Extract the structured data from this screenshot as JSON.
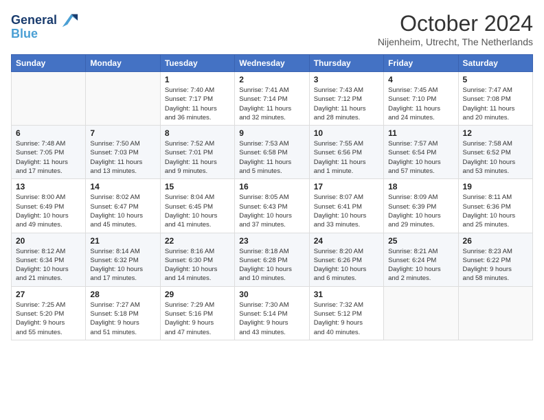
{
  "header": {
    "logo_line1": "General",
    "logo_line2": "Blue",
    "title": "October 2024",
    "subtitle": "Nijenheim, Utrecht, The Netherlands"
  },
  "calendar": {
    "days": [
      "Sunday",
      "Monday",
      "Tuesday",
      "Wednesday",
      "Thursday",
      "Friday",
      "Saturday"
    ],
    "weeks": [
      [
        {
          "day": "",
          "content": ""
        },
        {
          "day": "",
          "content": ""
        },
        {
          "day": "1",
          "content": "Sunrise: 7:40 AM\nSunset: 7:17 PM\nDaylight: 11 hours\nand 36 minutes."
        },
        {
          "day": "2",
          "content": "Sunrise: 7:41 AM\nSunset: 7:14 PM\nDaylight: 11 hours\nand 32 minutes."
        },
        {
          "day": "3",
          "content": "Sunrise: 7:43 AM\nSunset: 7:12 PM\nDaylight: 11 hours\nand 28 minutes."
        },
        {
          "day": "4",
          "content": "Sunrise: 7:45 AM\nSunset: 7:10 PM\nDaylight: 11 hours\nand 24 minutes."
        },
        {
          "day": "5",
          "content": "Sunrise: 7:47 AM\nSunset: 7:08 PM\nDaylight: 11 hours\nand 20 minutes."
        }
      ],
      [
        {
          "day": "6",
          "content": "Sunrise: 7:48 AM\nSunset: 7:05 PM\nDaylight: 11 hours\nand 17 minutes."
        },
        {
          "day": "7",
          "content": "Sunrise: 7:50 AM\nSunset: 7:03 PM\nDaylight: 11 hours\nand 13 minutes."
        },
        {
          "day": "8",
          "content": "Sunrise: 7:52 AM\nSunset: 7:01 PM\nDaylight: 11 hours\nand 9 minutes."
        },
        {
          "day": "9",
          "content": "Sunrise: 7:53 AM\nSunset: 6:58 PM\nDaylight: 11 hours\nand 5 minutes."
        },
        {
          "day": "10",
          "content": "Sunrise: 7:55 AM\nSunset: 6:56 PM\nDaylight: 11 hours\nand 1 minute."
        },
        {
          "day": "11",
          "content": "Sunrise: 7:57 AM\nSunset: 6:54 PM\nDaylight: 10 hours\nand 57 minutes."
        },
        {
          "day": "12",
          "content": "Sunrise: 7:58 AM\nSunset: 6:52 PM\nDaylight: 10 hours\nand 53 minutes."
        }
      ],
      [
        {
          "day": "13",
          "content": "Sunrise: 8:00 AM\nSunset: 6:49 PM\nDaylight: 10 hours\nand 49 minutes."
        },
        {
          "day": "14",
          "content": "Sunrise: 8:02 AM\nSunset: 6:47 PM\nDaylight: 10 hours\nand 45 minutes."
        },
        {
          "day": "15",
          "content": "Sunrise: 8:04 AM\nSunset: 6:45 PM\nDaylight: 10 hours\nand 41 minutes."
        },
        {
          "day": "16",
          "content": "Sunrise: 8:05 AM\nSunset: 6:43 PM\nDaylight: 10 hours\nand 37 minutes."
        },
        {
          "day": "17",
          "content": "Sunrise: 8:07 AM\nSunset: 6:41 PM\nDaylight: 10 hours\nand 33 minutes."
        },
        {
          "day": "18",
          "content": "Sunrise: 8:09 AM\nSunset: 6:39 PM\nDaylight: 10 hours\nand 29 minutes."
        },
        {
          "day": "19",
          "content": "Sunrise: 8:11 AM\nSunset: 6:36 PM\nDaylight: 10 hours\nand 25 minutes."
        }
      ],
      [
        {
          "day": "20",
          "content": "Sunrise: 8:12 AM\nSunset: 6:34 PM\nDaylight: 10 hours\nand 21 minutes."
        },
        {
          "day": "21",
          "content": "Sunrise: 8:14 AM\nSunset: 6:32 PM\nDaylight: 10 hours\nand 17 minutes."
        },
        {
          "day": "22",
          "content": "Sunrise: 8:16 AM\nSunset: 6:30 PM\nDaylight: 10 hours\nand 14 minutes."
        },
        {
          "day": "23",
          "content": "Sunrise: 8:18 AM\nSunset: 6:28 PM\nDaylight: 10 hours\nand 10 minutes."
        },
        {
          "day": "24",
          "content": "Sunrise: 8:20 AM\nSunset: 6:26 PM\nDaylight: 10 hours\nand 6 minutes."
        },
        {
          "day": "25",
          "content": "Sunrise: 8:21 AM\nSunset: 6:24 PM\nDaylight: 10 hours\nand 2 minutes."
        },
        {
          "day": "26",
          "content": "Sunrise: 8:23 AM\nSunset: 6:22 PM\nDaylight: 9 hours\nand 58 minutes."
        }
      ],
      [
        {
          "day": "27",
          "content": "Sunrise: 7:25 AM\nSunset: 5:20 PM\nDaylight: 9 hours\nand 55 minutes."
        },
        {
          "day": "28",
          "content": "Sunrise: 7:27 AM\nSunset: 5:18 PM\nDaylight: 9 hours\nand 51 minutes."
        },
        {
          "day": "29",
          "content": "Sunrise: 7:29 AM\nSunset: 5:16 PM\nDaylight: 9 hours\nand 47 minutes."
        },
        {
          "day": "30",
          "content": "Sunrise: 7:30 AM\nSunset: 5:14 PM\nDaylight: 9 hours\nand 43 minutes."
        },
        {
          "day": "31",
          "content": "Sunrise: 7:32 AM\nSunset: 5:12 PM\nDaylight: 9 hours\nand 40 minutes."
        },
        {
          "day": "",
          "content": ""
        },
        {
          "day": "",
          "content": ""
        }
      ]
    ]
  }
}
